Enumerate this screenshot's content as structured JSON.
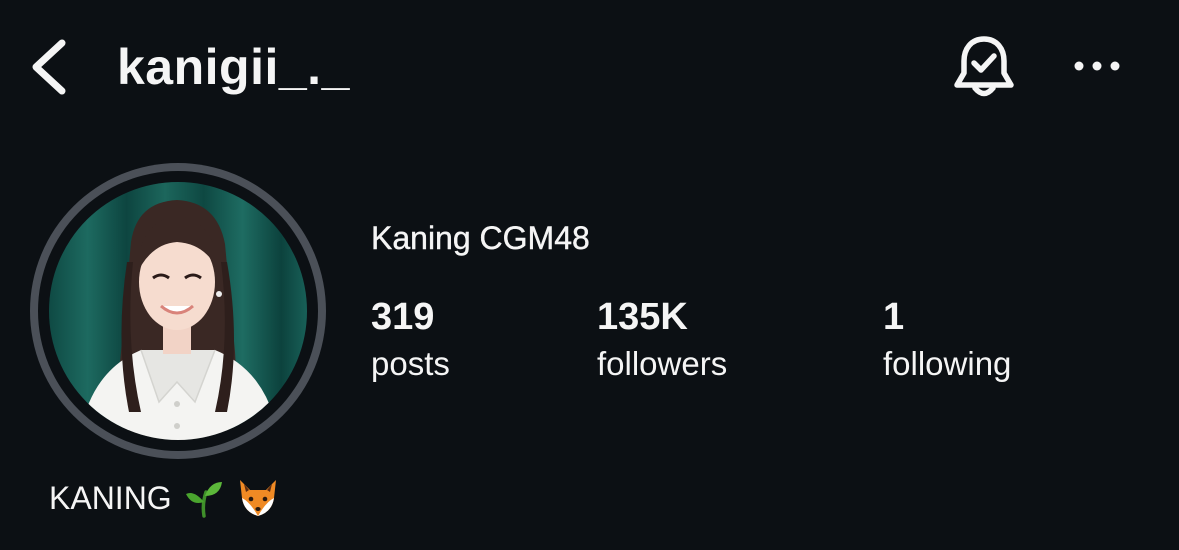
{
  "header": {
    "back_icon": "chevron-left-icon",
    "username": "kanigii_._",
    "bell_icon": "bell-check-icon",
    "more_icon": "more-horizontal-icon"
  },
  "profile": {
    "display_name": "Kaning CGM48",
    "avatar_icon": "profile-photo",
    "stats": [
      {
        "value": "319",
        "label": "posts"
      },
      {
        "value": "135K",
        "label": "followers"
      },
      {
        "value": "1",
        "label": "following"
      }
    ],
    "bio": {
      "text": "KANING",
      "emojis": [
        "seedling-emoji",
        "fox-emoji"
      ]
    }
  },
  "colors": {
    "background": "#0c1014",
    "text": "#f5f5f5",
    "ring": "#4b5058"
  }
}
